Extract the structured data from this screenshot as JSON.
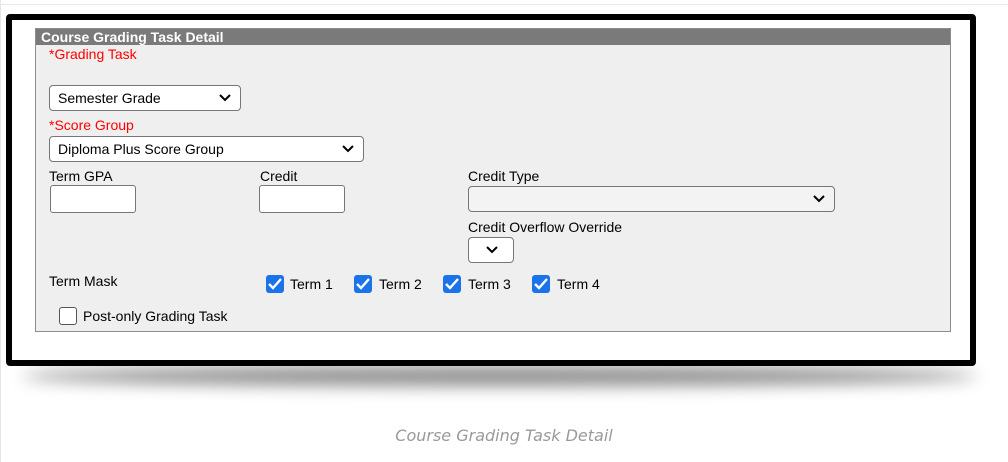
{
  "panel": {
    "header": "Course Grading Task Detail",
    "grading_task": {
      "label": "*Grading Task",
      "selected": "Semester Grade"
    },
    "score_group": {
      "label": "*Score Group",
      "selected": "Diploma Plus Score Group"
    },
    "term_gpa": {
      "label": "Term GPA",
      "value": ""
    },
    "credit": {
      "label": "Credit",
      "value": ""
    },
    "credit_type": {
      "label": "Credit Type",
      "selected": ""
    },
    "credit_overflow": {
      "label": "Credit Overflow Override",
      "selected": ""
    },
    "term_mask": {
      "label": "Term Mask",
      "terms": [
        {
          "label": "Term 1",
          "checked": true
        },
        {
          "label": "Term 2",
          "checked": true
        },
        {
          "label": "Term 3",
          "checked": true
        },
        {
          "label": "Term 4",
          "checked": true
        }
      ]
    },
    "post_only": {
      "label": "Post-only Grading Task",
      "checked": false
    }
  },
  "caption": "Course Grading Task Detail",
  "colors": {
    "header_bg": "#7a7a7a",
    "required": "#ff0000",
    "checkbox": "#1a73e8"
  }
}
